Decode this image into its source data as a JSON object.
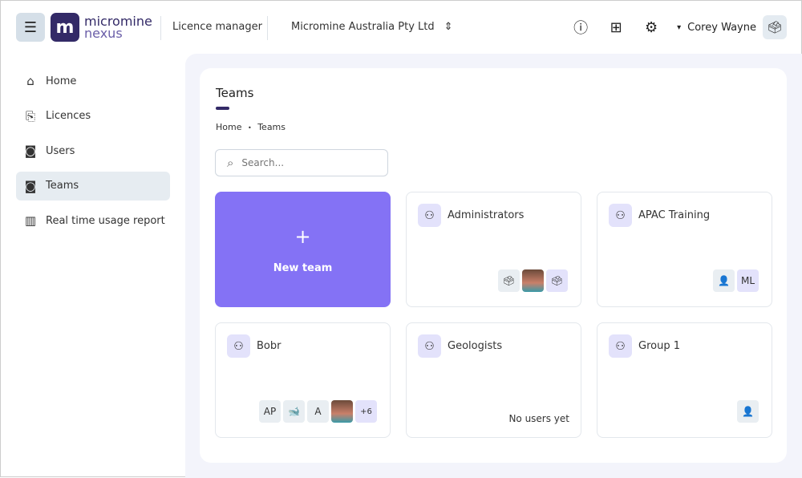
{
  "header": {
    "logo_top": "micromine",
    "logo_bottom": "nexus",
    "app_name": "Licence manager",
    "org": "Micromine Australia Pty Ltd",
    "user": "Corey Wayne"
  },
  "sidebar": {
    "items": [
      {
        "label": "Home"
      },
      {
        "label": "Licences"
      },
      {
        "label": "Users"
      },
      {
        "label": "Teams"
      },
      {
        "label": "Real time usage report"
      }
    ]
  },
  "main": {
    "title": "Teams",
    "breadcrumb": [
      "Home",
      "Teams"
    ],
    "breadcrumb_sep": "•",
    "search_placeholder": "Search...",
    "new_team": "New team",
    "new_team_icon": "+",
    "teams": [
      {
        "name": "Administrators",
        "avatars": [
          "🗳",
          "",
          "🗳"
        ]
      },
      {
        "name": "APAC Training",
        "avatars": [
          "👤",
          "ML"
        ]
      },
      {
        "name": "Bobr",
        "avatars": [
          "AP",
          "🐋",
          "A",
          "",
          "+6"
        ]
      },
      {
        "name": "Geologists",
        "empty": "No users yet"
      },
      {
        "name": "Group 1",
        "avatars": [
          "👤"
        ]
      }
    ]
  }
}
